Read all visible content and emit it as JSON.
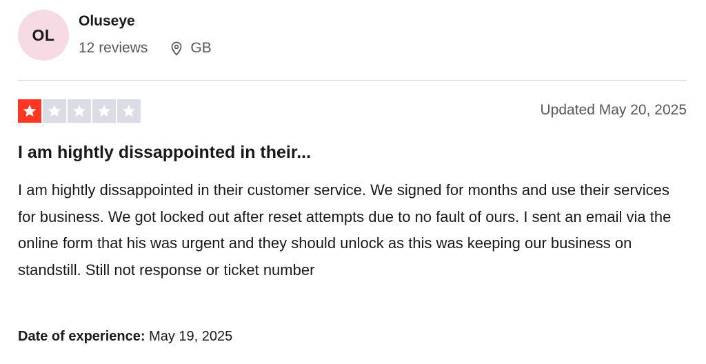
{
  "reviewer": {
    "initials": "OL",
    "name": "Oluseye",
    "review_count": "12 reviews",
    "location_icon": "location-pin-icon",
    "country": "GB",
    "avatar_color": "#f6dbe4"
  },
  "review": {
    "rating": 1,
    "rating_max": 5,
    "star_filled_color": "#ff3722",
    "star_empty_color": "#dcdce6",
    "updated": "Updated May 20, 2025",
    "title": "I am hightly dissappointed in their...",
    "body": "I am hightly dissappointed in their customer service. We signed for months and use their services for business. We got locked out after reset attempts due to no fault of ours. I sent an email via the online form that his was urgent and they should unlock as this was keeping our business on standstill. Still not response or ticket number",
    "date_of_experience_label": "Date of experience:",
    "date_of_experience": "May 19, 2025"
  }
}
